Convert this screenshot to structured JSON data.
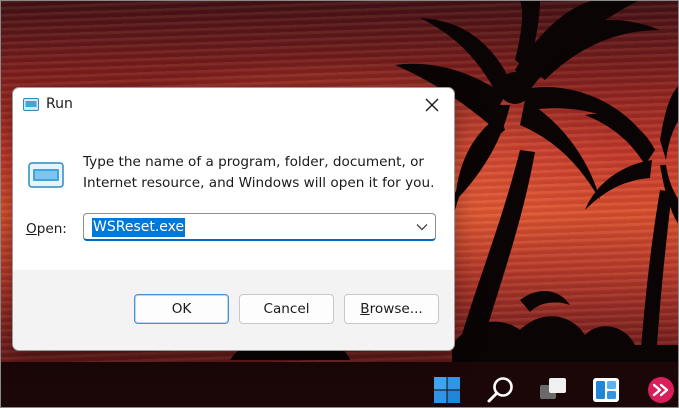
{
  "dialog": {
    "title": "Run",
    "close_glyph": "✕",
    "description": "Type the name of a program, folder, document, or Internet resource, and Windows will open it for you.",
    "open_label_accel": "O",
    "open_label_rest": "pen:",
    "open_value": "WSReset.exe",
    "buttons": {
      "ok": "OK",
      "cancel": "Cancel",
      "browse_accel": "B",
      "browse_rest": "rowse..."
    }
  },
  "taskbar": {
    "icons": [
      "windows-start-icon",
      "search-icon",
      "task-view-icon",
      "widgets-icon",
      "app-icon"
    ]
  },
  "colors": {
    "accent": "#0078d7",
    "footer_bg": "#f3f3f3",
    "wallpaper_orange": "#d8502f"
  }
}
